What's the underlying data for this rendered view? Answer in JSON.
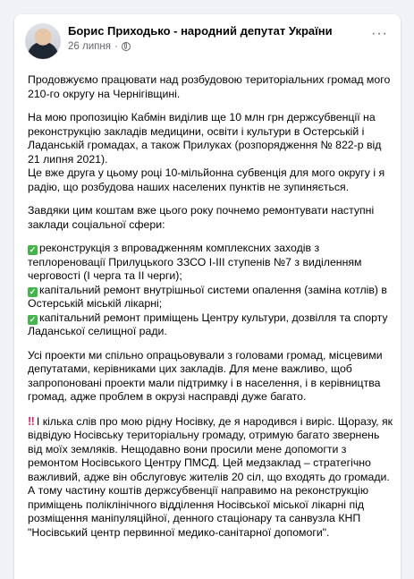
{
  "post": {
    "author": "Борис Приходько - народний депутат України",
    "date": "26 липня",
    "separator": "·",
    "more_label": "···",
    "paragraphs": [
      "Продовжуємо працювати над розбудовою територіальних громад мого 210-го округу на Чернігівщині.",
      "На мою пропозицію Кабмін виділив ще 10 млн грн держсубвенції на реконструкцію закладів медицини, освіти і культури в Остерській і Ладанській громадах, а також Прилуках (розпорядження № 822-р від 21 липня 2021).",
      "Це вже друга у цьому році 10-мільйонна субвенція для мого округу і я радію, що розбудова наших населених пунктів не зупиняється.",
      "Завдяки цим коштам вже цього року почнемо ремонтувати наступні заклади соціальної сфери:"
    ],
    "items": [
      "реконструкція з впровадженням комплексних заходів з теплореновації Прилуцького ЗЗСО І-ІІІ ступенів №7 з виділенням черговості (І черга та ІІ черги);",
      "капітальний ремонт внутрішньої системи опалення (заміна котлів) в Остерській міській лікарні;",
      "капітальний ремонт приміщень Центру культури, дозвілля та спорту Ладанської селищної ради."
    ],
    "paragraph_after": "Усі проекти ми спільно опрацьовували з головами громад, місцевими депутатами, керівниками цих закладів. Для мене важливо, щоб запропоновані проекти мали підтримку і в населення, і в керівництва громад, адже проблем в окрузі насправді дуже багато.",
    "highlight_paragraph": "І кілька слів про мою рідну Носівку, де я народився і виріс. Щоразу, як відвідую Носівську територіальну громаду, отримую багато звернень від моїх земляків. Нещодавно вони просили мене допомогти з ремонтом Носівського Центру ПМСД. Цей медзаклад – стратегічно важливий, адже він обслуговує жителів 20 сіл, що входять до громади. А тому частину коштів держсубвенції направимо на реконструкцію приміщень поліклінічного відділення Носівської міської лікарні під розміщення маніпуляційної, денного стаціонару та санвузла КНП \"Носівський центр первинної медико-санітарної допомоги\".",
    "check_icon": "✓",
    "bang_icon": "‼"
  }
}
